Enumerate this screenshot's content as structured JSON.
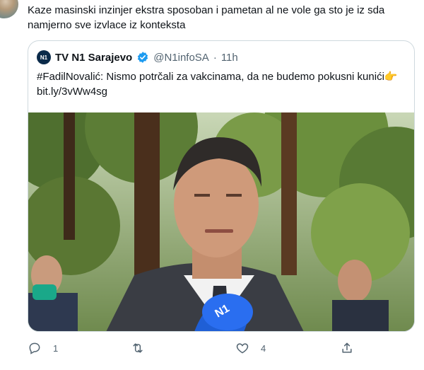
{
  "tweet": {
    "text": "Kaze masinski inzinjer ekstra sposoban i pametan al ne vole ga sto je iz sda namjerno sve izvlace iz konteksta"
  },
  "quoted": {
    "avatar_text": "N1",
    "name": "TV N1 Sarajevo",
    "handle": "@N1infoSA",
    "dot": "·",
    "time": "11h",
    "text": "#FadilNovalić: Nismo potrčali za vakcinama, da ne budemo pokusni kunići",
    "emoji": "👉",
    "link": "bit.ly/3vWw4sg",
    "mic_label": "N1"
  },
  "actions": {
    "reply_count": "1",
    "retweet_count": "",
    "like_count": "4",
    "share_count": ""
  },
  "colors": {
    "secondary_text": "#536471",
    "border": "#cfd9de",
    "verified_blue": "#1d9bf0"
  }
}
